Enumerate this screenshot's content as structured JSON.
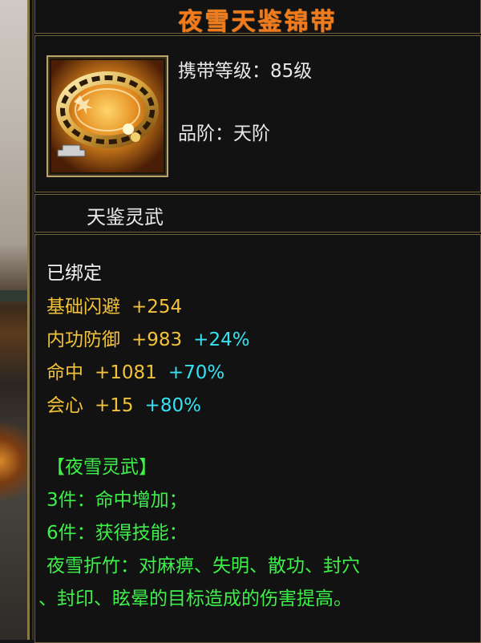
{
  "item": {
    "name": "夜雪天鉴锦带",
    "level_label": "携带等级：",
    "level_value": "85级",
    "grade_label": "品阶：",
    "grade_value": "天阶",
    "series": "天鉴灵武",
    "bound": "已绑定",
    "icon": "belt-icon"
  },
  "stats": [
    {
      "name": "基础闪避",
      "value": "+254",
      "bonus": ""
    },
    {
      "name": "内功防御",
      "value": "+983",
      "bonus": "+24%"
    },
    {
      "name": "命中",
      "value": "+1081",
      "bonus": "+70%"
    },
    {
      "name": "会心",
      "value": "+15",
      "bonus": "+80%"
    }
  ],
  "set": {
    "title": "【夜雪灵武】",
    "bonus_3": "3件：命中增加；",
    "bonus_6": "6件：获得技能：",
    "skill_line1": "夜雪折竹：对麻痹、失明、散功、封穴",
    "skill_line2": "、封印、眩晕的目标造成的伤害提高。"
  },
  "colors": {
    "title": "#f27a1b",
    "stat_name": "#f2c23a",
    "bonus": "#36e2f2",
    "set_text": "#3df04a",
    "border": "#6e6038"
  }
}
